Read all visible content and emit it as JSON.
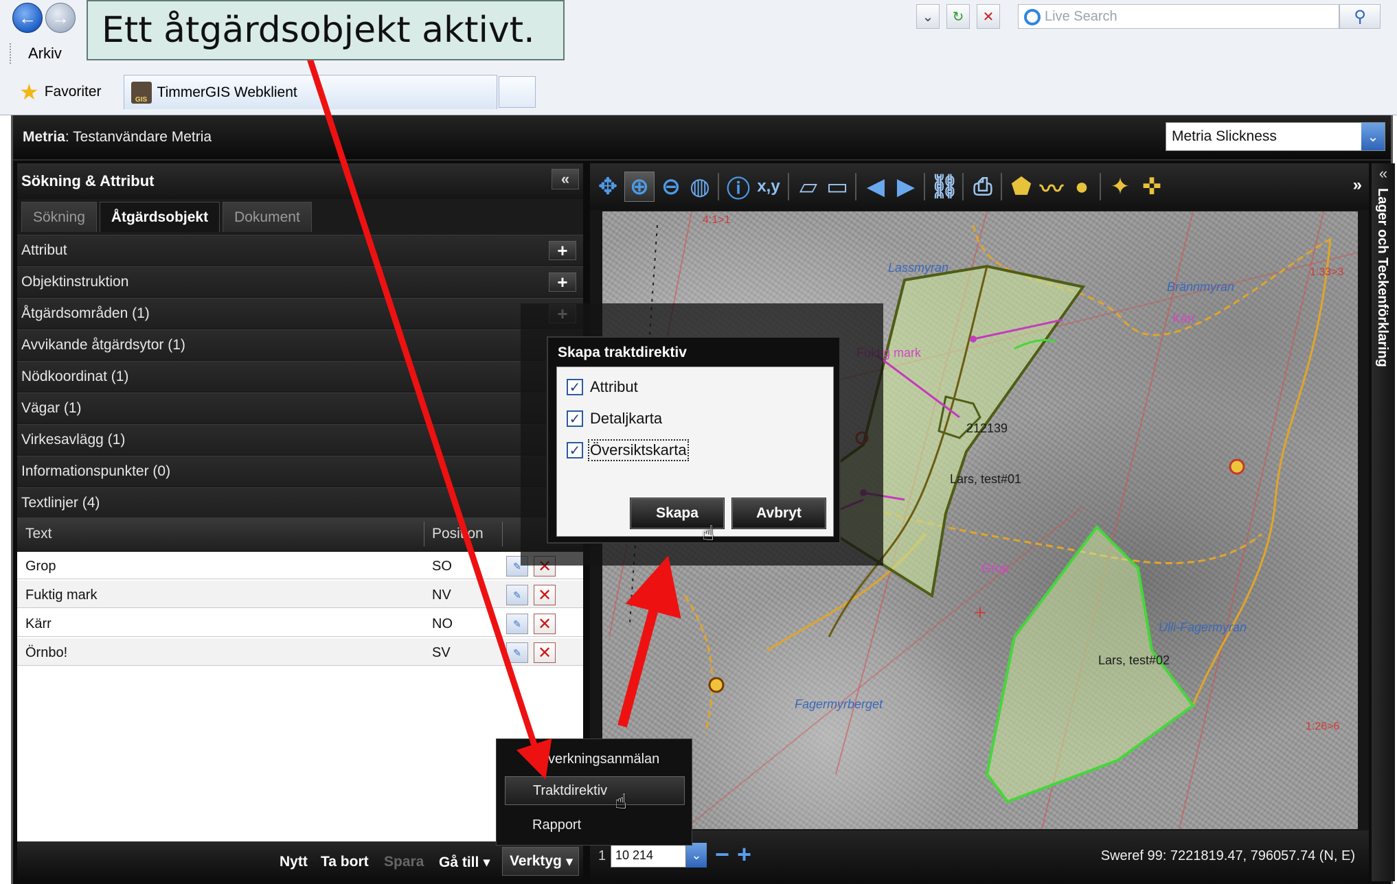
{
  "annotation": {
    "callout_text": "Ett åtgärdsobjekt aktivt."
  },
  "browser": {
    "menu_items": [
      "Arkiv"
    ],
    "live_search_placeholder": "Live Search",
    "favorites_label": "Favoriter",
    "tab_title": "TimmerGIS Webklient"
  },
  "app": {
    "brand": "Metria",
    "user": ": Testanvändare Metria",
    "theme_value": "Metria Slickness"
  },
  "left_panel": {
    "title": "Sökning & Attribut",
    "collapse_glyph": "«",
    "tabs": [
      {
        "label": "Sökning",
        "active": false
      },
      {
        "label": "Åtgärdsobjekt",
        "active": true
      },
      {
        "label": "Dokument",
        "active": false
      }
    ],
    "sections": [
      {
        "label": "Attribut"
      },
      {
        "label": "Objektinstruktion"
      },
      {
        "label": "Åtgärdsområden (1)"
      },
      {
        "label": "Avvikande åtgärdsytor (1)"
      },
      {
        "label": "Nödkoordinat (1)"
      },
      {
        "label": "Vägar (1)"
      },
      {
        "label": "Virkesavlägg (1)"
      },
      {
        "label": "Informationspunkter (0)"
      },
      {
        "label": "Textlinjer (4)"
      }
    ],
    "grid": {
      "columns": [
        "Text",
        "Position"
      ],
      "rows": [
        {
          "text": "Grop",
          "position": "SO"
        },
        {
          "text": "Fuktig mark",
          "position": "NV"
        },
        {
          "text": "Kärr",
          "position": "NO"
        },
        {
          "text": "Örnbo!",
          "position": "SV"
        }
      ]
    },
    "bottom_bar": {
      "nytt": "Nytt",
      "ta_bort": "Ta bort",
      "spara": "Spara",
      "ga_till": "Gå till",
      "verktyg": "Verktyg"
    }
  },
  "tools_menu": {
    "items": [
      {
        "label": "Avverkningsanmälan"
      },
      {
        "label": "Traktdirektiv"
      },
      {
        "label": "Rapport"
      }
    ]
  },
  "dialog": {
    "title": "Skapa traktdirektiv",
    "options": [
      {
        "label": "Attribut",
        "checked": true
      },
      {
        "label": "Detaljkarta",
        "checked": true
      },
      {
        "label": "Översiktskarta",
        "checked": true
      }
    ],
    "create_label": "Skapa",
    "cancel_label": "Avbryt"
  },
  "map": {
    "labels": {
      "lassmyran": "Lassmyran",
      "brannmyran": "Brännmyran",
      "karr": "Kärr",
      "fuktig": "Fuktig mark",
      "id_212": "212139",
      "lars01": "Lars, test#01",
      "grop": "Grop",
      "ulli": "Ulli-Fagermyran",
      "lars02": "Lars, test#02",
      "fagermyrberget": "Fagermyrberget",
      "ratio_a": "4:1>1",
      "ratio_b": "1:33>3",
      "ratio_c": "1:26>6"
    },
    "scale_prefix": "1 :",
    "scale_value": "10 214",
    "coordinates": "Sweref 99: 7221819.47, 796057.74 (N, E)"
  },
  "right_panel": {
    "title": "Lager och Teckenförklaring",
    "toggle_glyph": "«"
  },
  "colors": {
    "accent_blue": "#5a9df0",
    "area_fill": "#c9e39a",
    "area_border_dark": "#4f5d16",
    "area_border_bright": "#46d63b",
    "road": "#e0a52a",
    "annotation_arrow": "#ee1111"
  }
}
